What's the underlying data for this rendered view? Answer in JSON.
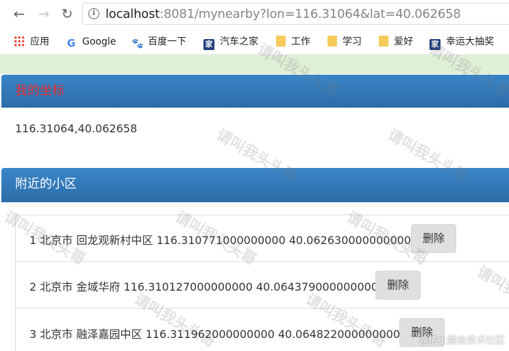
{
  "browser": {
    "url_host": "localhost",
    "url_rest": ":8081/mynearby?lon=116.31064&lat=40.062658",
    "bookmarks": [
      "应用",
      "Google",
      "百度一下",
      "汽车之家",
      "工作",
      "学习",
      "爱好",
      "幸运大抽奖"
    ]
  },
  "coord_panel": {
    "title": "我的坐标",
    "value": "116.31064,40.062658"
  },
  "nearby_panel": {
    "title": "附近的小区",
    "delete_label": "删除",
    "items": [
      "1 北京市 回龙观新村中区 116.310771000000000 40.062630000000000",
      "2 北京市 金域华府 116.310127000000000 40.064379000000000",
      "3 北京市 融泽嘉园中区 116.311962000000000 40.064822000000000"
    ]
  },
  "watermark_text": "请叫我头头哥",
  "corner_watermark": "@稀土掘金技术社区"
}
